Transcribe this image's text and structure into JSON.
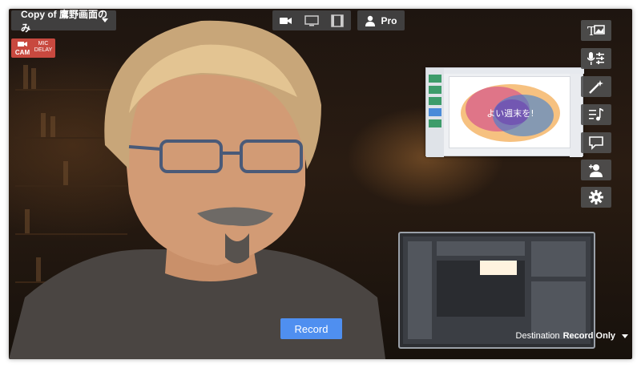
{
  "header": {
    "title_dropdown": "Copy of 鷹野画面のみ",
    "mode_icons": [
      "camera-icon",
      "monitor-icon",
      "film-icon"
    ],
    "pro_label": "Pro"
  },
  "badges": {
    "cam_label": "CAM",
    "mic_delay_label": "MIC DELAY"
  },
  "sidebar": {
    "items": [
      "text-image-icon",
      "mic-settings-icon",
      "magic-wand-icon",
      "music-list-icon",
      "comment-icon",
      "add-person-icon",
      "gear-icon"
    ]
  },
  "footer": {
    "record_label": "Record",
    "destination_label": "Destination",
    "destination_value": "Record Only"
  },
  "pip": {
    "slide_text": "よい週末を!"
  },
  "colors": {
    "record": "#4f8ff0",
    "cam_badge": "#c8493f",
    "control_bg": "#464646"
  }
}
